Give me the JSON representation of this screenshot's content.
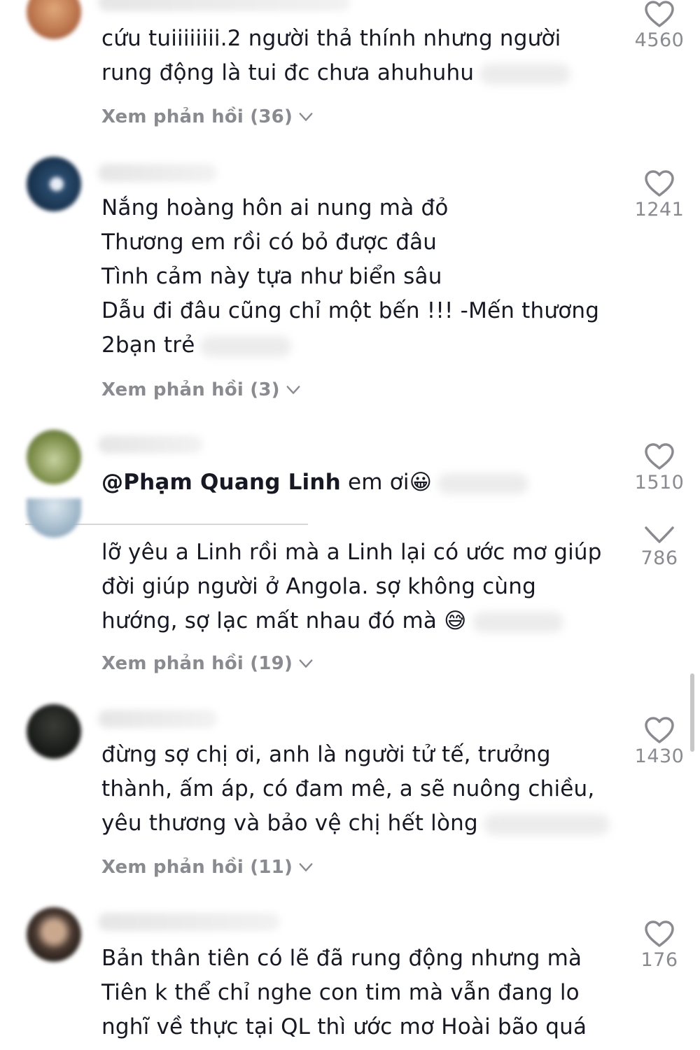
{
  "comments": [
    {
      "text": "cứu tuiiiiiiii.2 người thả thính nhưng người\nrung động là tui đc chưa ahuhuhu",
      "likes": "4560",
      "replies": "Xem phản hồi (36)",
      "avatar_color": "#c48a55"
    },
    {
      "text": "Nắng hoàng hôn ai nung mà đỏ\nThương em rồi có bỏ được đâu\nTình cảm này tựa như biển sâu\nDẫu đi đâu cũng chỉ một bến !!! -Mến thương\n2bạn trẻ",
      "likes": "1241",
      "replies": "Xem phản hồi (3)",
      "avatar_color": "#1f3d5c"
    },
    {
      "mention": "@Phạm Quang Linh",
      "text": " em ơi",
      "emoji": "😀",
      "likes": "1510",
      "avatar_color": "#6b7f3f"
    },
    {
      "text": "lỡ yêu a Linh rồi mà a Linh lại có ước mơ giúp\nđời giúp người ở Angola. sợ không cùng\nhướng, sợ lạc mất nhau đó mà ",
      "emoji": "😅",
      "likes": "786",
      "replies": "Xem phản hồi (19)",
      "avatar_color": "#9fb7c9"
    },
    {
      "text": "đừng sợ chị ơi, anh là người tử tế, trưởng\nthành, ấm áp, có đam mê, a sẽ nuông chiều,\nyêu thương và bảo vệ chị hết lòng",
      "likes": "1430",
      "replies": "Xem phản hồi (11)",
      "avatar_color": "#1a1c1a"
    },
    {
      "text": "Bản thân tiên có lẽ đã rung động nhưng mà\nTiên k thể chỉ nghe con tim mà vẫn đang lo\nnghĩ về thực tại QL thì ước mơ Hoài bão quá",
      "likes": "176",
      "avatar_color": "#4a3a32"
    }
  ],
  "icons": {
    "like": "heart-outline-icon",
    "expand": "chevron-down-icon"
  }
}
